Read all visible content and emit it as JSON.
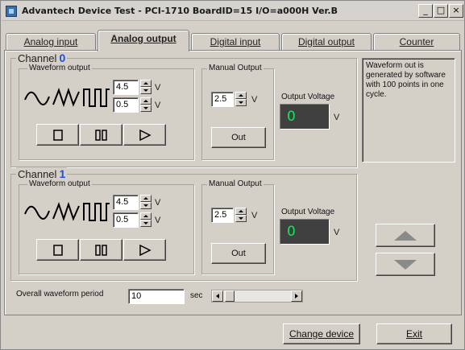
{
  "window": {
    "title": "Advantech Device Test - PCI-1710 BoardID=15 I/O=a000H Ver.B",
    "minimize": "_",
    "maximize": "□",
    "close": "×"
  },
  "tabs": [
    {
      "label": "Analog input",
      "active": false
    },
    {
      "label": "Analog output",
      "active": true
    },
    {
      "label": "Digital input",
      "active": false
    },
    {
      "label": "Digital output",
      "active": false
    },
    {
      "label": "Counter",
      "active": false
    }
  ],
  "channels": [
    {
      "label": "Channel",
      "number": "0",
      "waveform_label": "Waveform output",
      "high_value": "4.5",
      "low_value": "0.5",
      "unit": "V",
      "manual_label": "Manual Output",
      "manual_value": "2.5",
      "out_button": "Out",
      "voltage_label": "Output Voltage",
      "voltage_value": "0",
      "voltage_unit": "V"
    },
    {
      "label": "Channel",
      "number": "1",
      "waveform_label": "Waveform output",
      "high_value": "4.5",
      "low_value": "0.5",
      "unit": "V",
      "manual_label": "Manual Output",
      "manual_value": "2.5",
      "out_button": "Out",
      "voltage_label": "Output Voltage",
      "voltage_value": "0",
      "voltage_unit": "V"
    }
  ],
  "info_text": "Waveform out is generated by software with 100 points in one cycle.",
  "period": {
    "label": "Overall waveform period",
    "value": "10",
    "unit": "sec"
  },
  "footer": {
    "change_device": "Change device",
    "exit": "Exit"
  },
  "icons": {
    "sine": "sine-wave-icon",
    "triangle": "triangle-wave-icon",
    "square": "square-wave-icon",
    "stop": "stop-icon",
    "pause": "pause-icon",
    "play": "play-icon",
    "up": "up-arrow-icon",
    "down": "down-arrow-icon"
  }
}
